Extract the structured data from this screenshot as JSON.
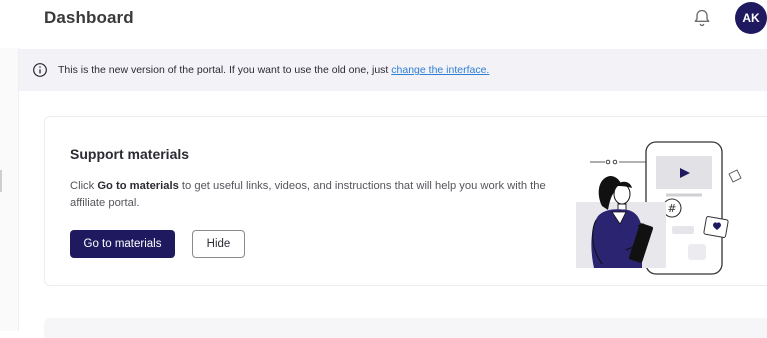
{
  "header": {
    "title": "Dashboard",
    "avatar_initials": "AK",
    "icons": {
      "notifications": "bell-icon"
    }
  },
  "notice": {
    "icon": "info-icon",
    "text": "This is the new version of the portal. If you want to use the old one, just ",
    "link_text": "change the interface."
  },
  "support_card": {
    "title": "Support materials",
    "desc_prefix": "Click ",
    "desc_bold": "Go to materials",
    "desc_suffix": " to get useful links, videos, and instructions that will help you work with the affiliate portal.",
    "primary_button": "Go to materials",
    "secondary_button": "Hide",
    "illustration": "person-with-tablet-illustration",
    "illustration_hashtag": "#"
  },
  "colors": {
    "brand": "#1f1a5f",
    "link": "#2f7fd4",
    "notice_bg": "#f2f2f7"
  }
}
